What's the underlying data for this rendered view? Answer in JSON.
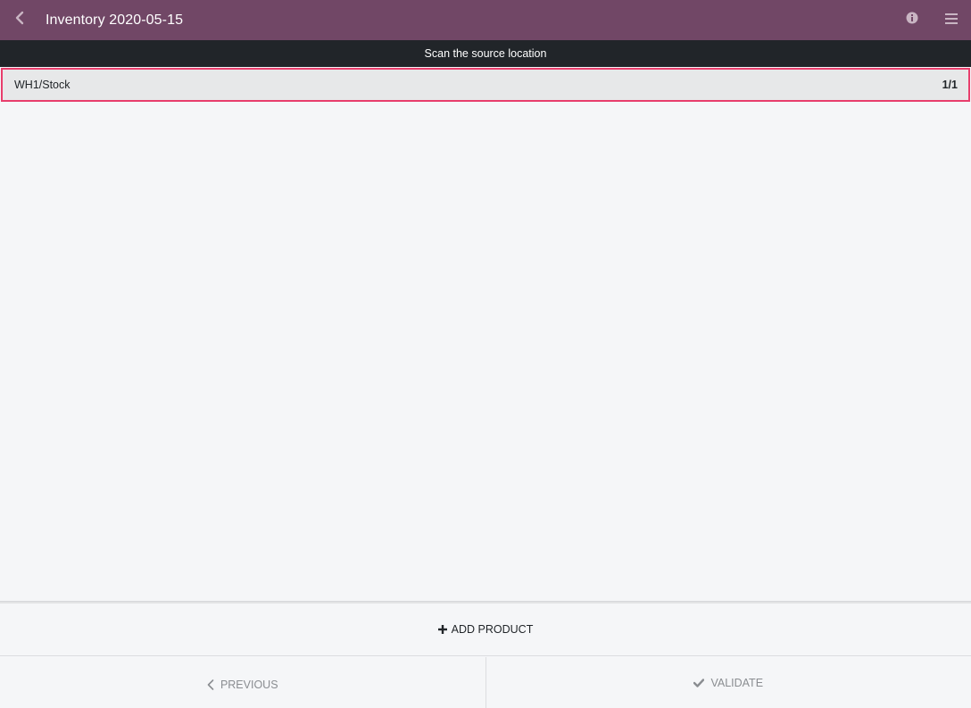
{
  "header": {
    "title": "Inventory 2020-05-15",
    "back_icon": "chevron-left-icon",
    "info_icon": "info-circle-icon",
    "menu_icon": "hamburger-menu-icon",
    "background_color": "#714766"
  },
  "scan_bar": {
    "message": "Scan the source location"
  },
  "location": {
    "name": "WH1/Stock",
    "count": "1/1",
    "highlight_color": "#e83e6c"
  },
  "actions": {
    "add_product_label": "ADD PRODUCT",
    "add_icon": "plus-icon",
    "previous_label": "PREVIOUS",
    "previous_icon": "chevron-left-icon",
    "validate_label": "VALIDATE",
    "validate_icon": "check-icon"
  }
}
